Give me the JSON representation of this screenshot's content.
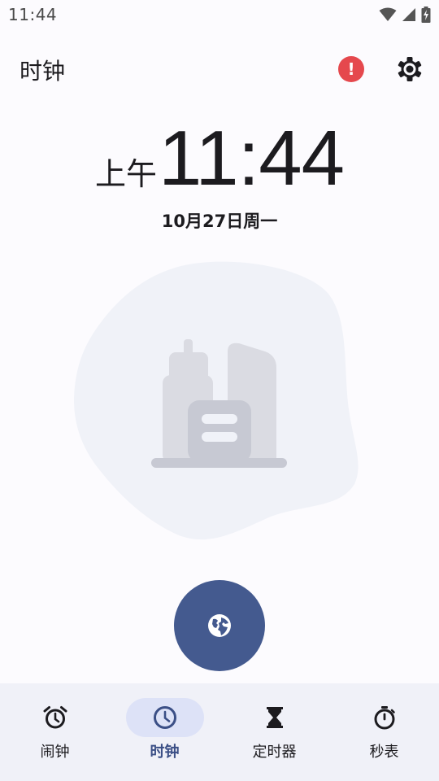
{
  "status_bar": {
    "time": "11:44"
  },
  "header": {
    "title": "时钟",
    "alert_icon": "alert-icon",
    "settings_icon": "gear-icon"
  },
  "clock": {
    "ampm": "上午",
    "time": "11:44",
    "date": "10月27日周一"
  },
  "fab": {
    "icon": "globe-icon"
  },
  "nav": {
    "items": [
      {
        "label": "闹钟",
        "icon": "alarm-clock-icon",
        "active": false
      },
      {
        "label": "时钟",
        "icon": "clock-icon",
        "active": true
      },
      {
        "label": "定时器",
        "icon": "hourglass-icon",
        "active": false
      },
      {
        "label": "秒表",
        "icon": "stopwatch-icon",
        "active": false
      }
    ]
  },
  "colors": {
    "accent": "#445a8f",
    "active_pill": "#dde2f7",
    "alert": "#e5484d",
    "nav_bg": "#f0f1f8"
  }
}
